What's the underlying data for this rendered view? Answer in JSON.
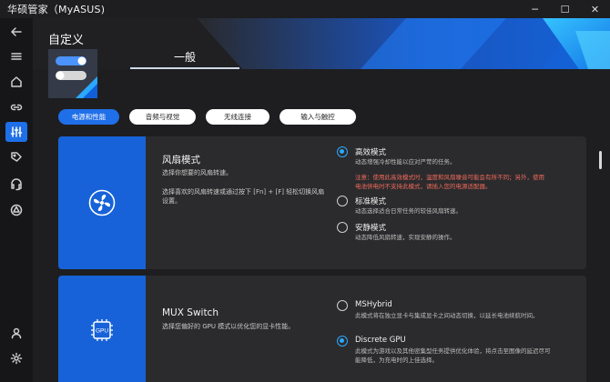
{
  "window": {
    "title": "华硕管家（MyASUS)",
    "controls": [
      "minimize",
      "maximize",
      "close"
    ]
  },
  "sidebar": {
    "items": [
      {
        "icon": "back-arrow-icon"
      },
      {
        "icon": "menu-icon"
      },
      {
        "icon": "home-icon"
      },
      {
        "icon": "link-icon"
      },
      {
        "icon": "sliders-icon",
        "active": true
      },
      {
        "icon": "tag-icon"
      },
      {
        "icon": "headset-icon"
      },
      {
        "icon": "triangle-icon"
      },
      {
        "icon": "user-icon"
      },
      {
        "icon": "gear-icon"
      }
    ]
  },
  "header": {
    "page_title": "自定义",
    "tab_label": "一般"
  },
  "chips": [
    {
      "label": "电源和性能",
      "active": true
    },
    {
      "label": "音频与视觉",
      "active": false
    },
    {
      "label": "无线连接",
      "active": false
    },
    {
      "label": "输入与触控",
      "active": false
    }
  ],
  "fan_card": {
    "title": "风扇模式",
    "desc1": "选择你想要的风扇转速。",
    "desc2": "选择喜欢的风扇转速或通过按下 [Fn] + [F] 轻松切换风扇设置。",
    "options": [
      {
        "label": "高效模式",
        "desc": "动态增强冷却性能以应对严苛的任务。",
        "checked": true,
        "warning": "注意：使用此高效模式时，温度和风扇噪音可能会有所不同；另外，使用电池供电时不支持此模式，请插入您的电源适配器。"
      },
      {
        "label": "标准模式",
        "desc": "动态选择适合日常任务的较佳风扇转速。",
        "checked": false
      },
      {
        "label": "安静模式",
        "desc": "动态降低风扇转速，实现安静的操作。",
        "checked": false
      }
    ]
  },
  "mux_card": {
    "title": "MUX Switch",
    "desc": "选择您偏好的 GPU 模式以优化您的显卡性能。",
    "icon_text": "GPU",
    "options": [
      {
        "label": "MSHybrid",
        "desc": "此模式将在独立显卡与集成显卡之间动态切换，以延长电池续航时间。",
        "checked": false
      },
      {
        "label": "Discrete GPU",
        "desc": "此模式为游戏以及其他密集型任务提供优化体验，将点击至图像的延迟尽可能降低，为充电时的上佳选择。",
        "checked": true
      }
    ]
  },
  "colors": {
    "accent": "#1f6fe8",
    "radio_checked": "#2aa8ff",
    "warning": "#f06a5a"
  }
}
